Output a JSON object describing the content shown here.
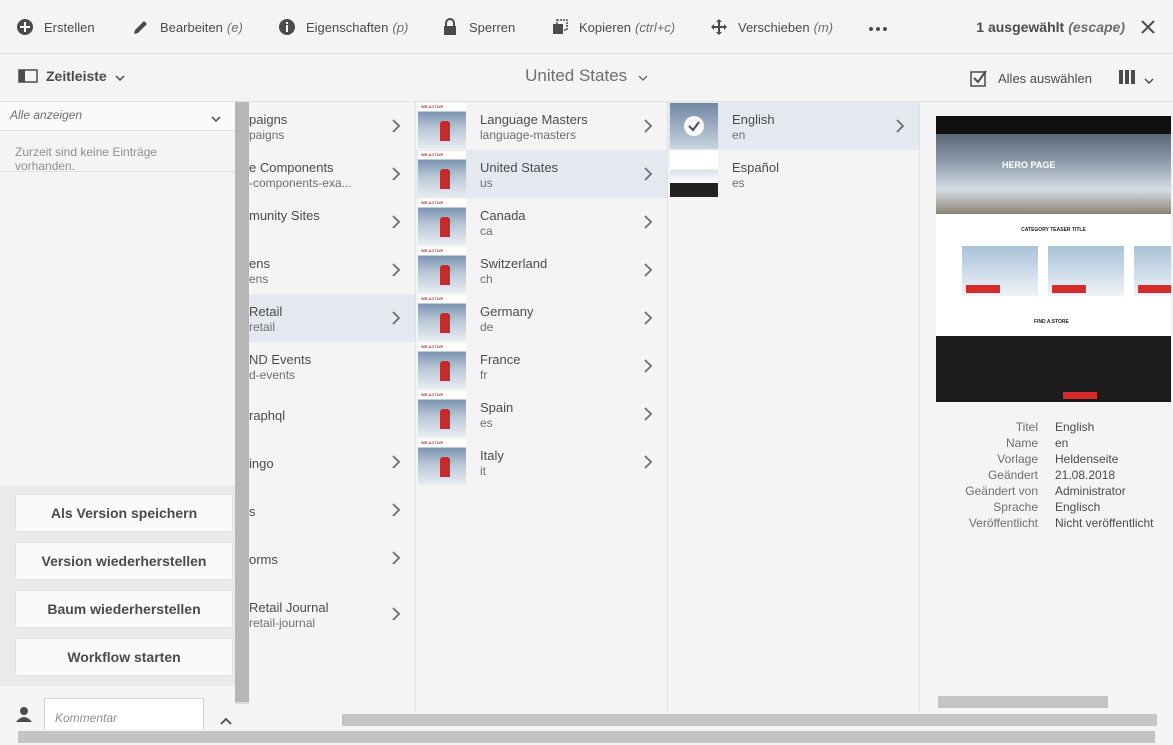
{
  "toolbar": {
    "create": "Erstellen",
    "edit": "Bearbeiten",
    "edit_sc": "(e)",
    "props": "Eigenschaften",
    "props_sc": "(p)",
    "lock": "Sperren",
    "copy": "Kopieren",
    "copy_sc": "(ctrl+c)",
    "move": "Verschieben",
    "move_sc": "(m)",
    "selected": "1 ausgewählt",
    "selected_sc": "(escape)"
  },
  "subbar": {
    "rail_label": "Zeitleiste",
    "breadcrumb": "United States",
    "select_all": "Alles auswählen"
  },
  "rail": {
    "filter": "Alle anzeigen",
    "empty": "Zurzeit sind keine Einträge vorhanden.",
    "buttons": [
      "Als Version speichern",
      "Version wiederherstellen",
      "Baum wiederherstellen",
      "Workflow starten"
    ],
    "comment_placeholder": "Kommentar"
  },
  "col1": [
    {
      "t1": "paigns",
      "t2": "paigns",
      "chev": true
    },
    {
      "t1": "e Components",
      "t2": "-components-exa...",
      "chev": true
    },
    {
      "t1": "munity Sites",
      "t2": "",
      "chev": true
    },
    {
      "t1": "ens",
      "t2": "ens",
      "chev": true
    },
    {
      "t1": "Retail",
      "t2": "retail",
      "chev": true,
      "sel": true
    },
    {
      "t1": "ND Events",
      "t2": "d-events",
      "chev": false
    },
    {
      "t1": "raphql",
      "t2": "",
      "chev": false
    },
    {
      "t1": "ingo",
      "t2": "",
      "chev": true
    },
    {
      "t1": "s",
      "t2": "",
      "chev": true
    },
    {
      "t1": "orms",
      "t2": "",
      "chev": true
    },
    {
      "t1": "Retail Journal",
      "t2": "retail-journal",
      "chev": true
    }
  ],
  "col2": [
    {
      "t1": "Language Masters",
      "t2": "language-masters"
    },
    {
      "t1": "United States",
      "t2": "us",
      "sel": true
    },
    {
      "t1": "Canada",
      "t2": "ca"
    },
    {
      "t1": "Switzerland",
      "t2": "ch"
    },
    {
      "t1": "Germany",
      "t2": "de"
    },
    {
      "t1": "France",
      "t2": "fr"
    },
    {
      "t1": "Spain",
      "t2": "es"
    },
    {
      "t1": "Italy",
      "t2": "it"
    }
  ],
  "col3": [
    {
      "t1": "English",
      "t2": "en",
      "sel": true,
      "chev": true
    },
    {
      "t1": "Español",
      "t2": "es",
      "chev": false
    }
  ],
  "thumb_logo": "WE.ACTIVE",
  "preview": {
    "hero": "HERO PAGE",
    "category": "CATEGORY TEASER TITLE",
    "store": "FIND A STORE",
    "meta": [
      {
        "k": "Titel",
        "v": "English"
      },
      {
        "k": "Name",
        "v": "en"
      },
      {
        "k": "Vorlage",
        "v": "Heldenseite"
      },
      {
        "k": "Geändert",
        "v": "21.08.2018"
      },
      {
        "k": "Geändert von",
        "v": "Administrator"
      },
      {
        "k": "Sprache",
        "v": "Englisch"
      },
      {
        "k": "Veröffentlicht",
        "v": "Nicht veröffentlicht"
      }
    ]
  }
}
